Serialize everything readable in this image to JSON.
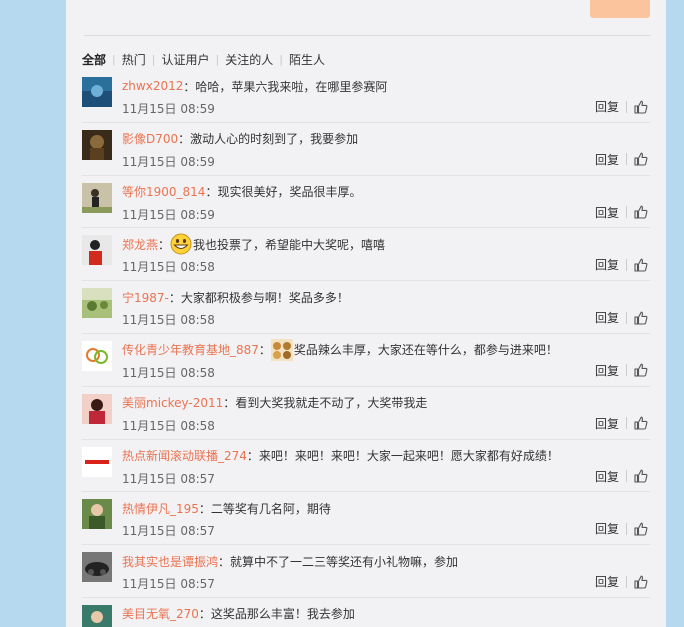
{
  "tabs": [
    {
      "label": "全部"
    },
    {
      "label": "热门"
    },
    {
      "label": "认证用户"
    },
    {
      "label": "关注的人"
    },
    {
      "label": "陌生人"
    }
  ],
  "comments": [
    {
      "user": "zhwx2012",
      "text": "哈哈，苹果六我来啦，在哪里参赛阿",
      "time": "11月15日 08:59",
      "reply": "回复",
      "emoji": ""
    },
    {
      "user": "影像D700",
      "text": "激动人心的时刻到了，我要参加",
      "time": "11月15日 08:59",
      "reply": "回复",
      "emoji": ""
    },
    {
      "user": "等你1900_814",
      "text": "现实很美好，奖品很丰厚。",
      "time": "11月15日 08:59",
      "reply": "回复",
      "emoji": ""
    },
    {
      "user": "郑龙燕",
      "text": "我也投票了，希望能中大奖呢，嘻嘻",
      "time": "11月15日 08:58",
      "reply": "回复",
      "emoji": "grin-emoji"
    },
    {
      "user": "宁1987-",
      "text": "大家都积极参与啊！奖品多多！",
      "time": "11月15日 08:58",
      "reply": "回复",
      "emoji": ""
    },
    {
      "user": "传化青少年教育基地_887",
      "text": "奖品辣么丰厚，大家还在等什么，都参与进来吧！",
      "time": "11月15日 08:58",
      "reply": "回复",
      "emoji": "doge-emoji"
    },
    {
      "user": "美丽mickey-2011",
      "text": "看到大奖我就走不动了，大奖带我走",
      "time": "11月15日 08:58",
      "reply": "回复",
      "emoji": ""
    },
    {
      "user": "热点新闻滚动联播_274",
      "text": "来吧！来吧！来吧！大家一起来吧！愿大家都有好成绩！",
      "time": "11月15日 08:57",
      "reply": "回复",
      "emoji": ""
    },
    {
      "user": "热情伊凡_195",
      "text": "二等奖有几名阿，期待",
      "time": "11月15日 08:57",
      "reply": "回复",
      "emoji": ""
    },
    {
      "user": "我其实也是谭振鸿",
      "text": "就算中不了一二三等奖还有小礼物嘛，参加",
      "time": "11月15日 08:57",
      "reply": "回复",
      "emoji": ""
    },
    {
      "user": "美目无氧_270",
      "text": "这奖品那么丰富！我去参加",
      "time": "",
      "reply": "",
      "emoji": ""
    }
  ],
  "colors": {
    "username": "#eb7350",
    "panel": "#f2f2f5",
    "background": "#b7d9ef"
  }
}
